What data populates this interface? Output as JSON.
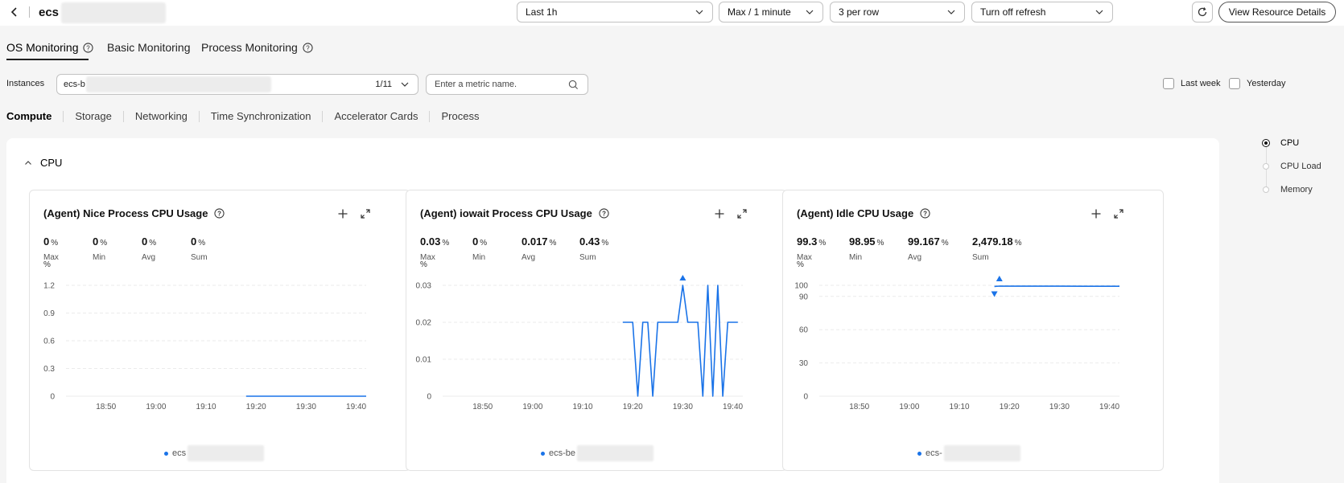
{
  "header": {
    "title": "ecs",
    "time_range": "Last 1h",
    "aggregation": "Max / 1 minute",
    "layout": "3 per row",
    "refresh": "Turn off refresh",
    "view_details": "View Resource Details"
  },
  "main_tabs": [
    "OS Monitoring",
    "Basic Monitoring",
    "Process Monitoring"
  ],
  "instances": {
    "label": "Instances",
    "value": "ecs-b",
    "count": "1/11",
    "search_placeholder": "Enter a metric name."
  },
  "compare": {
    "last_week": "Last week",
    "yesterday": "Yesterday"
  },
  "sub_tabs": [
    "Compute",
    "Storage",
    "Networking",
    "Time Synchronization",
    "Accelerator Cards",
    "Process"
  ],
  "section": {
    "title": "CPU"
  },
  "anchor_nav": [
    "CPU",
    "CPU Load",
    "Memory"
  ],
  "stat_labels": {
    "max": "Max",
    "min": "Min",
    "avg": "Avg",
    "sum": "Sum"
  },
  "cards": [
    {
      "title": "(Agent) Nice Process CPU Usage",
      "stats": {
        "max": "0",
        "min": "0",
        "avg": "0",
        "sum": "0"
      },
      "unit": "%",
      "legend": "ecs"
    },
    {
      "title": "(Agent) iowait Process CPU Usage",
      "stats": {
        "max": "0.03",
        "min": "0",
        "avg": "0.017",
        "sum": "0.43"
      },
      "unit": "%",
      "legend": "ecs-be"
    },
    {
      "title": "(Agent) Idle CPU Usage",
      "stats": {
        "max": "99.3",
        "min": "98.95",
        "avg": "99.167",
        "sum": "2,479.18"
      },
      "unit": "%",
      "legend": "ecs-"
    }
  ],
  "colors": {
    "series": "#1a73e8"
  },
  "chart_data": [
    {
      "type": "line",
      "title": "(Agent) Nice Process CPU Usage",
      "ylabel": "%",
      "x_ticks": [
        "18:50",
        "19:00",
        "19:10",
        "19:20",
        "19:30",
        "19:40"
      ],
      "y_ticks": [
        "0",
        "0.3",
        "0.6",
        "0.9",
        "1.2"
      ],
      "ylim": [
        0,
        1.2
      ],
      "xlim": [
        "18:42",
        "19:42"
      ],
      "grid": true,
      "series": [
        {
          "x": [
            "19:18",
            "19:24",
            "19:30",
            "19:36",
            "19:42"
          ],
          "y": [
            0,
            0,
            0,
            0,
            0
          ]
        }
      ]
    },
    {
      "type": "line",
      "title": "(Agent) iowait Process CPU Usage",
      "ylabel": "%",
      "x_ticks": [
        "18:50",
        "19:00",
        "19:10",
        "19:20",
        "19:30",
        "19:40"
      ],
      "y_ticks": [
        "0",
        "0.01",
        "0.02",
        "0.03"
      ],
      "ylim": [
        0,
        0.03
      ],
      "xlim": [
        "18:42",
        "19:42"
      ],
      "grid": true,
      "markers": [
        {
          "kind": "max",
          "x": "19:30",
          "y": 0.03
        }
      ],
      "series": [
        {
          "x": [
            "19:18",
            "19:20",
            "19:21",
            "19:22",
            "19:23",
            "19:24",
            "19:25",
            "19:26",
            "19:27",
            "19:28",
            "19:29",
            "19:30",
            "19:31",
            "19:32",
            "19:33",
            "19:34",
            "19:35",
            "19:36",
            "19:37",
            "19:38",
            "19:39",
            "19:40",
            "19:41"
          ],
          "y": [
            0.02,
            0.02,
            0,
            0.02,
            0.02,
            0,
            0.02,
            0.02,
            0.02,
            0.02,
            0.02,
            0.03,
            0.02,
            0.02,
            0.02,
            0,
            0.03,
            0,
            0.03,
            0,
            0.02,
            0.02,
            0.02
          ]
        }
      ]
    },
    {
      "type": "line",
      "title": "(Agent) Idle CPU Usage",
      "ylabel": "%",
      "x_ticks": [
        "18:50",
        "19:00",
        "19:10",
        "19:20",
        "19:30",
        "19:40"
      ],
      "y_ticks": [
        "0",
        "30",
        "60",
        "90",
        "100"
      ],
      "ylim": [
        0,
        100
      ],
      "xlim": [
        "18:42",
        "19:42"
      ],
      "grid": true,
      "markers": [
        {
          "kind": "max",
          "x": "19:18",
          "y": 99.3
        },
        {
          "kind": "min",
          "x": "19:17",
          "y": 98.95
        }
      ],
      "series": [
        {
          "x": [
            "19:17",
            "19:18",
            "19:20",
            "19:25",
            "19:30",
            "19:35",
            "19:40",
            "19:42"
          ],
          "y": [
            98.95,
            99.3,
            99.2,
            99.2,
            99.2,
            99.15,
            99.1,
            99.1
          ]
        }
      ]
    }
  ]
}
